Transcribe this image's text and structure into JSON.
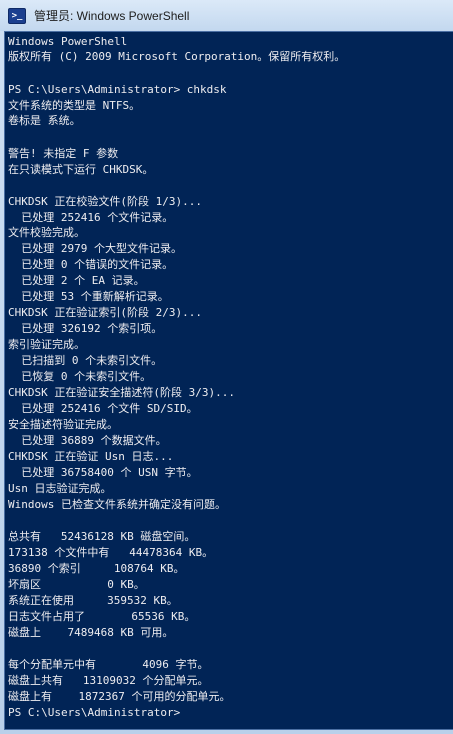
{
  "window": {
    "title": "管理员: Windows PowerShell",
    "icon": "powershell-icon"
  },
  "console": {
    "background": "#012456",
    "foreground": "#eeedf0",
    "lines": [
      "Windows PowerShell",
      "版权所有 (C) 2009 Microsoft Corporation。保留所有权利。",
      "PS C:\\Users\\Administrator> chkdsk",
      "文件系统的类型是 NTFS。",
      "卷标是 系统。",
      "警告! 未指定 F 参数",
      "在只读模式下运行 CHKDSK。",
      "CHKDSK 正在校验文件(阶段 1/3)...",
      "  已处理 252416 个文件记录。",
      "文件校验完成。",
      "  已处理 2979 个大型文件记录。",
      "  已处理 0 个错误的文件记录。",
      "  已处理 2 个 EA 记录。",
      "  已处理 53 个重新解析记录。",
      "CHKDSK 正在验证索引(阶段 2/3)...",
      "  已处理 326192 个索引项。",
      "索引验证完成。",
      "  已扫描到 0 个未索引文件。",
      "  已恢复 0 个未索引文件。",
      "CHKDSK 正在验证安全描述符(阶段 3/3)...",
      "  已处理 252416 个文件 SD/SID。",
      "安全描述符验证完成。",
      "  已处理 36889 个数据文件。",
      "CHKDSK 正在验证 Usn 日志...",
      "  已处理 36758400 个 USN 字节。",
      "Usn 日志验证完成。",
      "Windows 已检查文件系统并确定没有问题。",
      "总共有   52436128 KB 磁盘空间。",
      "173138 个文件中有   44478364 KB。",
      "36890 个索引     108764 KB。",
      "坏扇区          0 KB。",
      "系统正在使用     359532 KB。",
      "日志文件占用了       65536 KB。",
      "磁盘上    7489468 KB 可用。",
      "每个分配单元中有       4096 字节。",
      "磁盘上共有   13109032 个分配单元。",
      "磁盘上有    1872367 个可用的分配单元。",
      "PS C:\\Users\\Administrator>"
    ]
  }
}
